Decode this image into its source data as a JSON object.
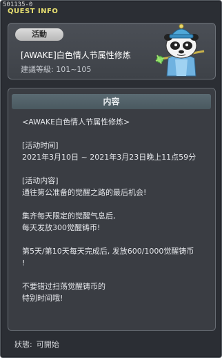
{
  "window": {
    "quest_id": "501135-0",
    "title": "QUEST INFO"
  },
  "header": {
    "category": "活動",
    "quest_name": "[AWAKE]白色情人节属性修炼",
    "level_label": "建議等級: 101~105"
  },
  "content": {
    "heading": "内容",
    "lines": [
      "<AWAKE白色情人节属性修炼>",
      "",
      "[活动时间]",
      "2021年3月10日 ~ 2021年3月23日晚上11点59分",
      "",
      "[活动内容]",
      "通往第公准备的觉醒之路的最后机会!",
      "",
      "集齐每天限定的觉醒气息后,",
      "每天发放300觉醒铸币!",
      "",
      "第5天/第10天每天完成后, 发放600/1000觉醒铸币",
      "!",
      "",
      "不要错过扫荡觉醒铸币的",
      "特别时间哦!"
    ]
  },
  "footer": {
    "status_label": "狀態:",
    "status_value": "可開始"
  },
  "colors": {
    "window_bg": "#2b2e34",
    "title_text": "#e8e070",
    "heading_bar": "#4a5960",
    "badge_bg": "#c8c8c8"
  },
  "icons": {
    "close": "close-icon",
    "npc": "npc-portrait-panda"
  }
}
